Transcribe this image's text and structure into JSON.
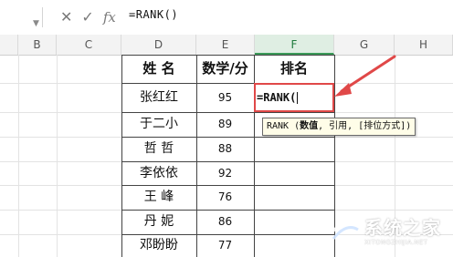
{
  "formula_bar": {
    "cancel_icon": "✕",
    "confirm_icon": "✓",
    "fx_icon": "fx",
    "formula": "=RANK()"
  },
  "columns": [
    "B",
    "C",
    "D",
    "E",
    "F",
    "G",
    "H"
  ],
  "table": {
    "headers": [
      "姓 名",
      "数学/分",
      "排名"
    ],
    "rows": [
      {
        "name": "张红红",
        "score": "95"
      },
      {
        "name": "于二小",
        "score": "89"
      },
      {
        "name": "哲 哲",
        "score": "88"
      },
      {
        "name": "李依依",
        "score": "92"
      },
      {
        "name": "王 峰",
        "score": "76"
      },
      {
        "name": "丹 妮",
        "score": "86"
      },
      {
        "name": "邓盼盼",
        "score": "77"
      }
    ]
  },
  "active_cell": {
    "text": "=RANK("
  },
  "tooltip": {
    "prefix": "RANK (",
    "bold_arg": "数值",
    "rest": ", 引用, [排位方式])"
  },
  "watermark": {
    "brand": "系统之家",
    "url": "XITONGZHIJIA.NET"
  },
  "colors": {
    "accent_red": "#e04848",
    "active_col_green": "#3a9a58"
  }
}
